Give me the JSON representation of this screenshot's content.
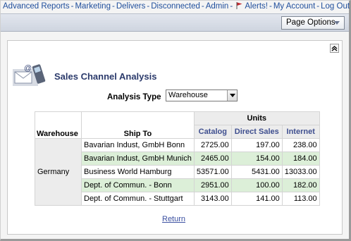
{
  "topnav": {
    "links": [
      "Advanced Reports",
      "Marketing",
      "Delivers",
      "Disconnected",
      "Admin",
      "Alerts!",
      "My Account",
      "Log Out"
    ]
  },
  "toolbar": {
    "page_options": "Page Options"
  },
  "report": {
    "title": "Sales Channel Analysis",
    "analysis_type_label": "Analysis Type",
    "analysis_type_value": "Warehouse",
    "units_header": "Units",
    "col_warehouse": "Warehouse",
    "col_ship_to": "Ship To",
    "col_catalog": "Catalog",
    "col_direct_sales": "Direct Sales",
    "col_internet": "Internet",
    "warehouse": "Germany",
    "rows": [
      {
        "ship_to": "Bavarian Indust, GmbH Bonn",
        "catalog": "2725.00",
        "direct": "197.00",
        "internet": "238.00"
      },
      {
        "ship_to": "Bavarian Indust, GmbH Munich",
        "catalog": "2465.00",
        "direct": "154.00",
        "internet": "184.00"
      },
      {
        "ship_to": "Business World Hamburg",
        "catalog": "53571.00",
        "direct": "5431.00",
        "internet": "13033.00"
      },
      {
        "ship_to": "Dept. of Commun. - Bonn",
        "catalog": "2951.00",
        "direct": "100.00",
        "internet": "182.00"
      },
      {
        "ship_to": "Dept. of Commun. - Stuttgart",
        "catalog": "3143.00",
        "direct": "141.00",
        "internet": "113.00"
      }
    ],
    "return_label": "Return"
  },
  "colors": {
    "link": "#1f4e9c",
    "title": "#2b3a6b",
    "row_highlight": "#dcefd8",
    "alert_flag": "#c0262d"
  },
  "icons": [
    "alert-flag-icon",
    "chevron-down-icon",
    "collapse-up-icon",
    "phone-mail-icon"
  ]
}
